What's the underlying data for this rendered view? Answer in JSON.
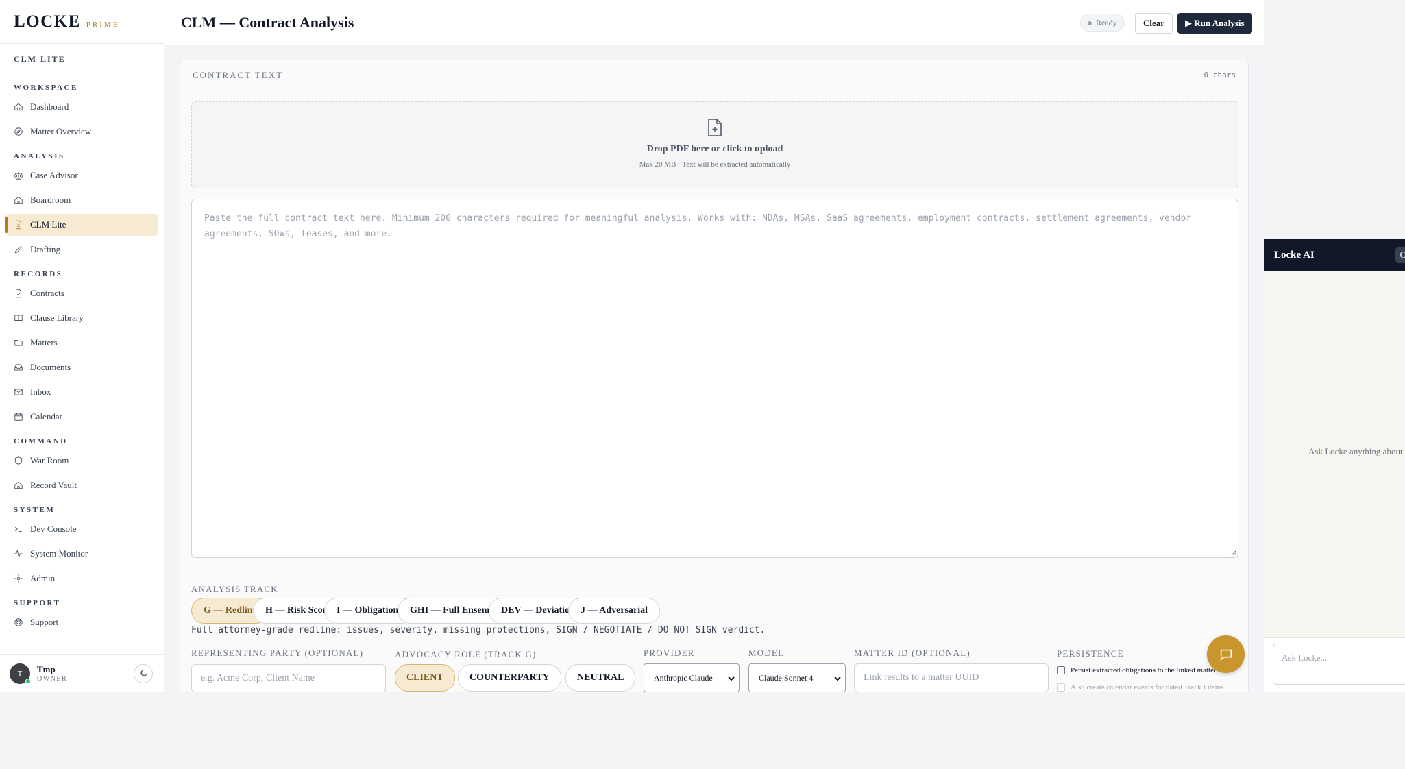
{
  "brand": {
    "name": "LOCKE",
    "tier": "PRIME"
  },
  "sidebar": {
    "crumb": "CLM LITE",
    "sections": [
      {
        "label": "WORKSPACE",
        "items": [
          {
            "label": "Dashboard",
            "icon": "home-icon"
          },
          {
            "label": "Matter Overview",
            "icon": "compass-icon"
          }
        ]
      },
      {
        "label": "ANALYSIS",
        "items": [
          {
            "label": "Case Advisor",
            "icon": "scale-icon"
          },
          {
            "label": "Boardroom",
            "icon": "building-icon"
          },
          {
            "label": "CLM Lite",
            "icon": "file-text-icon",
            "active": true
          },
          {
            "label": "Drafting",
            "icon": "pen-icon"
          }
        ]
      },
      {
        "label": "RECORDS",
        "items": [
          {
            "label": "Contracts",
            "icon": "file-check-icon"
          },
          {
            "label": "Clause Library",
            "icon": "book-icon"
          },
          {
            "label": "Matters",
            "icon": "folder-icon"
          },
          {
            "label": "Documents",
            "icon": "inbox-tray-icon"
          },
          {
            "label": "Inbox",
            "icon": "mail-icon"
          },
          {
            "label": "Calendar",
            "icon": "calendar-icon"
          }
        ]
      },
      {
        "label": "COMMAND",
        "items": [
          {
            "label": "War Room",
            "icon": "shield-icon"
          },
          {
            "label": "Record Vault",
            "icon": "vault-icon"
          }
        ]
      },
      {
        "label": "SYSTEM",
        "items": [
          {
            "label": "Dev Console",
            "icon": "terminal-icon"
          },
          {
            "label": "System Monitor",
            "icon": "activity-icon"
          },
          {
            "label": "Admin",
            "icon": "gear-icon"
          }
        ]
      },
      {
        "label": "SUPPORT",
        "items": [
          {
            "label": "Support",
            "icon": "lifebuoy-icon"
          }
        ]
      }
    ],
    "user": {
      "initial": "T",
      "name": "Tmp",
      "role": "OWNER"
    }
  },
  "header": {
    "title": "CLM — Contract Analysis",
    "status": "Ready",
    "clear_label": "Clear",
    "run_label": "▶ Run Analysis"
  },
  "contract": {
    "title": "CONTRACT TEXT",
    "char_count": "0 chars",
    "drop_title": "Drop PDF here or click to upload",
    "drop_sub": "Max 20 MB · Text will be extracted automatically",
    "placeholder": "Paste the full contract text here. Minimum 200 characters required for meaningful analysis. Works with: NDAs, MSAs, SaaS agreements, employment contracts, settlement agreements, vendor agreements, SOWs, leases, and more."
  },
  "analysis": {
    "label": "ANALYSIS TRACK",
    "tracks": [
      "G — Redline",
      "H — Risk Score",
      "I — Obligations",
      "GHI — Full Ensemble",
      "DEV — Deviation",
      "J — Adversarial"
    ],
    "selected_track": "G — Redline",
    "description": "Full attorney-grade redline: issues, severity, missing protections, SIGN / NEGOTIATE / DO NOT SIGN verdict."
  },
  "options": {
    "party_label": "REPRESENTING PARTY (OPTIONAL)",
    "party_placeholder": "e.g. Acme Corp, Client Name",
    "role_label": "ADVOCACY ROLE (TRACK G)",
    "roles": [
      "CLIENT",
      "COUNTERPARTY",
      "NEUTRAL"
    ],
    "selected_role": "CLIENT",
    "provider_label": "PROVIDER",
    "provider_value": "Anthropic Claude",
    "model_label": "MODEL",
    "model_value": "Claude Sonnet 4",
    "matter_label": "MATTER ID (OPTIONAL)",
    "matter_placeholder": "Link results to a matter UUID",
    "persistence_label": "PERSISTENCE",
    "persist_obligations": "Persist extracted obligations to the linked matter",
    "persist_calendar": "Also create calendar events for dated Track I items"
  },
  "ai_panel": {
    "title": "Locke AI",
    "close_glyph": "C",
    "empty_text": "Ask Locke anything about this",
    "input_placeholder": "Ask Locke..."
  },
  "colors": {
    "accent": "#b7791f",
    "navy": "#1e293b",
    "fab": "#c9962e"
  }
}
